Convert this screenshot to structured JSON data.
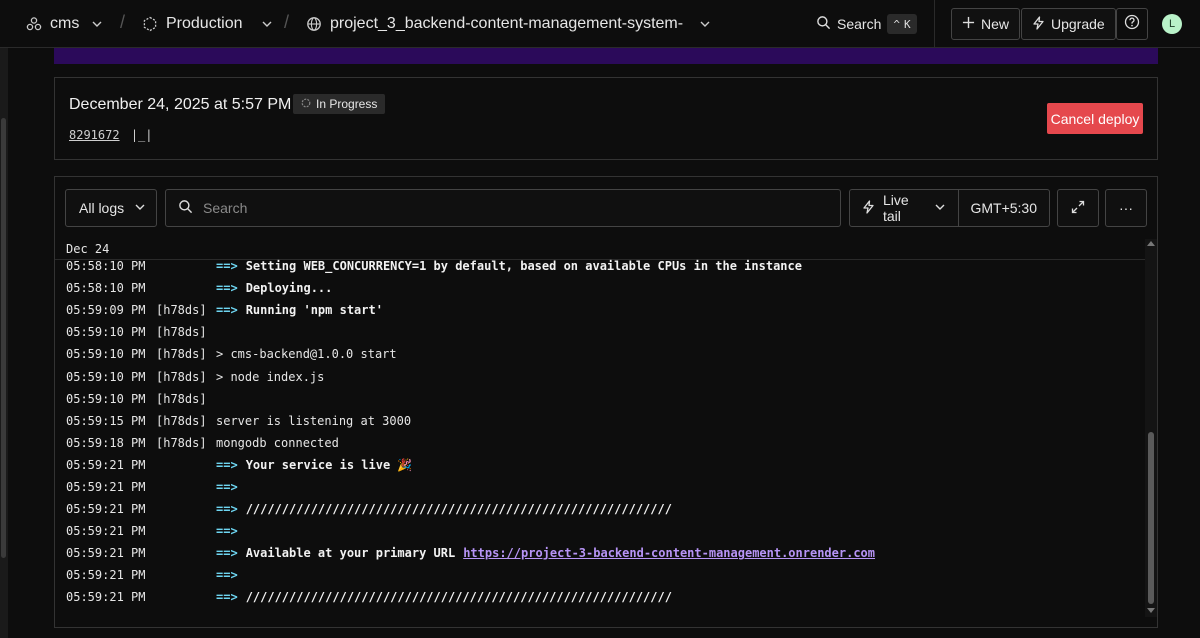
{
  "nav": {
    "workspace": "cms",
    "environment": "Production",
    "service": "project_3_backend-content-management-system-",
    "search_label": "Search",
    "search_shortcut": "K",
    "new_label": "New",
    "upgrade_label": "Upgrade",
    "avatar_initial": "L"
  },
  "deploy": {
    "date": "December 24, 2025 at 5:57 PM",
    "status": "In Progress",
    "commit_hash": "8291672",
    "commit_message": "|_|",
    "cancel_label": "Cancel deploy"
  },
  "logs": {
    "filter": "All logs",
    "search_placeholder": "Search",
    "live_tail": "Live tail",
    "timezone": "GMT+5:30",
    "date_header": "Dec 24",
    "rows": [
      {
        "ts": "05:58:10 PM",
        "inst": "",
        "arrow": "==>",
        "text": "Setting WEB_CONCURRENCY=1 by default, based on available CPUs in the instance",
        "bold": true,
        "link": ""
      },
      {
        "ts": "05:58:10 PM",
        "inst": "",
        "arrow": "==>",
        "text": "Deploying...",
        "bold": true,
        "link": ""
      },
      {
        "ts": "05:59:09 PM",
        "inst": "[h78ds]",
        "arrow": "==>",
        "text": "Running 'npm start'",
        "bold": true,
        "link": ""
      },
      {
        "ts": "05:59:10 PM",
        "inst": "[h78ds]",
        "arrow": "",
        "text": "",
        "bold": false,
        "link": ""
      },
      {
        "ts": "05:59:10 PM",
        "inst": "[h78ds]",
        "arrow": "",
        "text": "> cms-backend@1.0.0 start",
        "bold": false,
        "link": ""
      },
      {
        "ts": "05:59:10 PM",
        "inst": "[h78ds]",
        "arrow": "",
        "text": "> node index.js",
        "bold": false,
        "link": ""
      },
      {
        "ts": "05:59:10 PM",
        "inst": "[h78ds]",
        "arrow": "",
        "text": "",
        "bold": false,
        "link": ""
      },
      {
        "ts": "05:59:15 PM",
        "inst": "[h78ds]",
        "arrow": "",
        "text": "server is listening at 3000",
        "bold": false,
        "link": ""
      },
      {
        "ts": "05:59:18 PM",
        "inst": "[h78ds]",
        "arrow": "",
        "text": "mongodb connected",
        "bold": false,
        "link": ""
      },
      {
        "ts": "05:59:21 PM",
        "inst": "",
        "arrow": "==>",
        "text": "Your service is live 🎉",
        "bold": true,
        "link": ""
      },
      {
        "ts": "05:59:21 PM",
        "inst": "",
        "arrow": "==>",
        "text": "",
        "bold": true,
        "link": ""
      },
      {
        "ts": "05:59:21 PM",
        "inst": "",
        "arrow": "==>",
        "text": "///////////////////////////////////////////////////////////",
        "bold": true,
        "link": ""
      },
      {
        "ts": "05:59:21 PM",
        "inst": "",
        "arrow": "==>",
        "text": "",
        "bold": true,
        "link": ""
      },
      {
        "ts": "05:59:21 PM",
        "inst": "",
        "arrow": "==>",
        "text": "Available at your primary URL",
        "bold": true,
        "link": "https://project-3-backend-content-management.onrender.com"
      },
      {
        "ts": "05:59:21 PM",
        "inst": "",
        "arrow": "==>",
        "text": "",
        "bold": true,
        "link": ""
      },
      {
        "ts": "05:59:21 PM",
        "inst": "",
        "arrow": "==>",
        "text": "///////////////////////////////////////////////////////////",
        "bold": true,
        "link": ""
      }
    ]
  },
  "icons": {
    "workspace": "workspace-icon",
    "environment": "environment-icon",
    "service": "globe-icon",
    "search": "search-icon",
    "plus": "plus-icon",
    "bolt": "bolt-icon",
    "help": "help-icon",
    "expand": "expand-icon",
    "more": "more-icon"
  }
}
